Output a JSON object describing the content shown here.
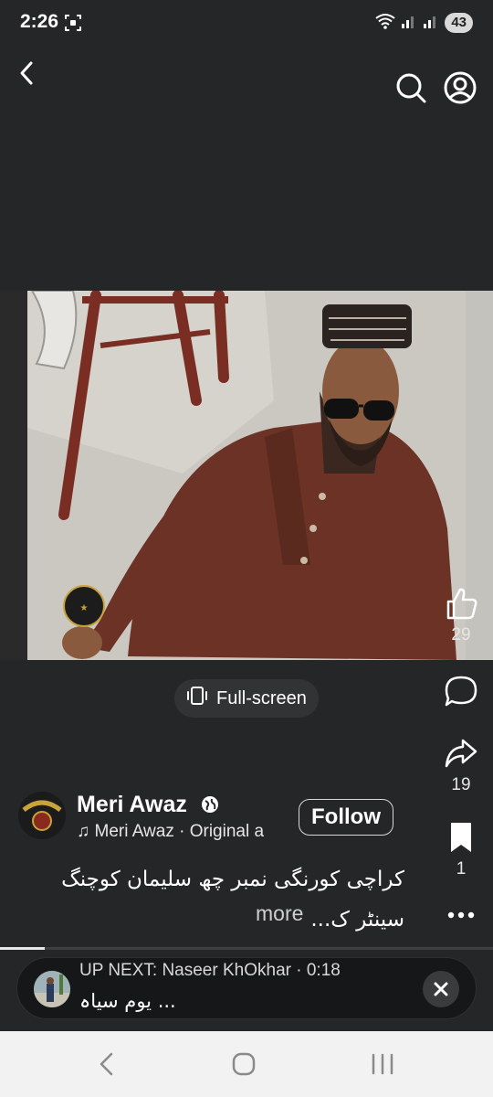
{
  "status_bar": {
    "time": "2:26",
    "battery": "43",
    "icons": [
      "screenshot-icon",
      "wifi-icon",
      "signal-icon",
      "signal-icon"
    ]
  },
  "top_bar": {
    "icons": [
      "back-chevron-icon",
      "search-icon",
      "profile-icon"
    ]
  },
  "player": {
    "fullscreen_label": "Full-screen"
  },
  "actions": {
    "like_count": "29",
    "share_count": "19",
    "save_count": "1",
    "icons": [
      "like-icon",
      "comment-icon",
      "share-icon",
      "bookmark-icon",
      "more-icon"
    ]
  },
  "author": {
    "name": "Meri Awaz",
    "audio": "Meri Awaz · Original a",
    "follow_label": "Follow"
  },
  "caption": {
    "text": "کراچی کورنگی نمبر چھ سلیمان کوچنگ سینٹر ک...",
    "more": "more"
  },
  "playback": {
    "progress": 0.09
  },
  "up_next": {
    "title": "UP NEXT: Naseer KhOkhar · 0:18",
    "subtitle": "یوم سیاہ ..."
  },
  "colors": {
    "background": "#252628",
    "nav_bar": "#f2f2f2"
  }
}
